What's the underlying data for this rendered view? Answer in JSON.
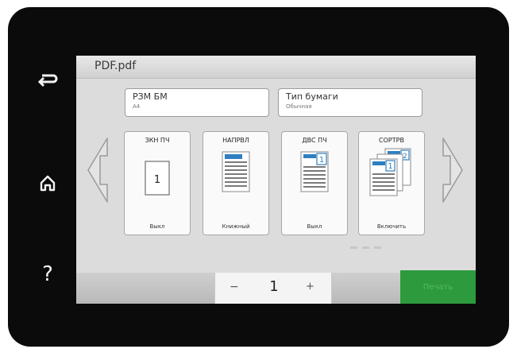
{
  "window": {
    "title": "PDF.pdf"
  },
  "sidebar": {
    "back_icon": "back-arrow-icon",
    "home_icon": "home-icon",
    "help_icon": "question-mark-icon",
    "help_label": "?"
  },
  "fields": [
    {
      "label": "РЗМ БМ",
      "value": "A4"
    },
    {
      "label": "Тип бумаги",
      "value": "Обычная"
    }
  ],
  "options": [
    {
      "title": "ЗКН ПЧ",
      "value": "Выкл",
      "preview_number": "1"
    },
    {
      "title": "НАПРВЛ",
      "value": "Книжный"
    },
    {
      "title": "ДВС ПЧ",
      "value": "Выкл",
      "preview_number": "1"
    },
    {
      "title": "СОРТРВ",
      "value": "Включить",
      "preview_number_back": "2",
      "preview_number_front": "1"
    }
  ],
  "copies": {
    "minus": "−",
    "count": "1",
    "plus": "+"
  },
  "print_button": {
    "label": "Печать"
  },
  "colors": {
    "accent_blue": "#2e7fc1",
    "print_green": "#2d9a3e",
    "bezel": "#0b0b0b"
  }
}
